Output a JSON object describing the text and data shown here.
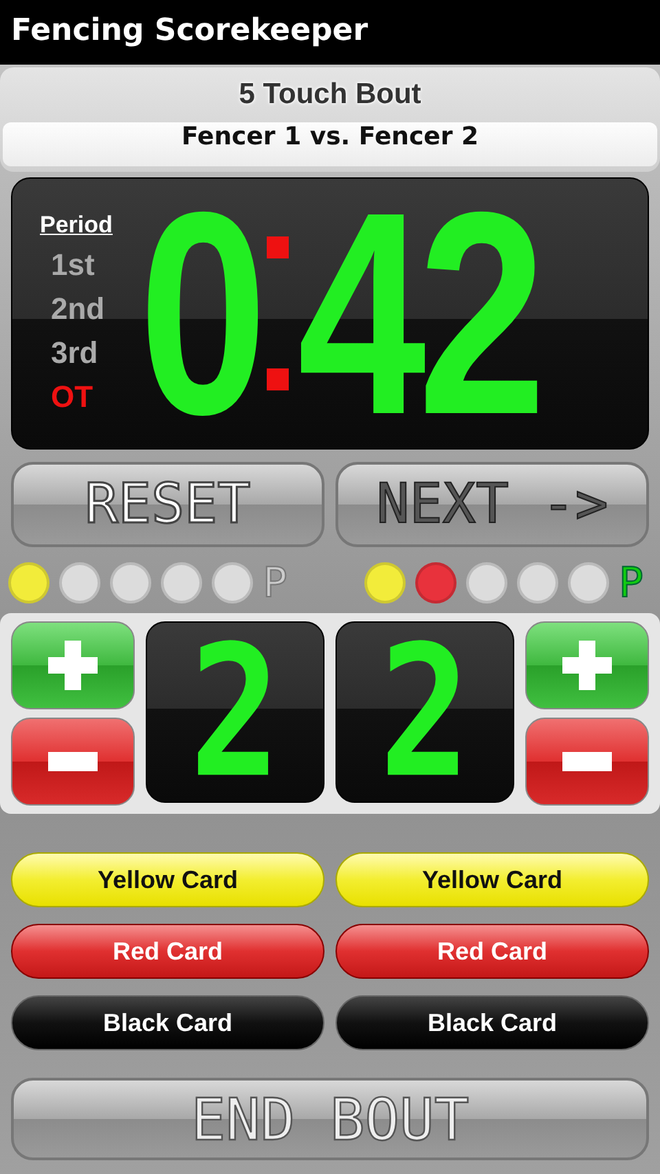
{
  "app_bar": {
    "title": "Fencing Scorekeeper"
  },
  "bout": {
    "name": "5 Touch Bout",
    "matchup": "Fencer 1 vs. Fencer 2"
  },
  "clock": {
    "period_heading": "Period",
    "periods": [
      {
        "label": "1st",
        "selected": false
      },
      {
        "label": "2nd",
        "selected": false
      },
      {
        "label": "3rd",
        "selected": false
      },
      {
        "label": "OT",
        "selected": true
      }
    ],
    "minutes": "0",
    "seconds": "42"
  },
  "clock_buttons": [
    {
      "label": "RESET",
      "kind": "outline"
    },
    {
      "label": "NEXT ->",
      "kind": "plain"
    }
  ],
  "fencers": [
    {
      "lights": [
        {
          "color": "#f2ec3a"
        },
        {
          "color": "#dcdcdc"
        },
        {
          "color": "#dcdcdc"
        },
        {
          "color": "#dcdcdc"
        },
        {
          "color": "#dcdcdc"
        }
      ],
      "priority": {
        "label": "P",
        "on": false
      },
      "score": "2",
      "cards": [
        {
          "kind": "yellow",
          "label": "Yellow Card"
        },
        {
          "kind": "red",
          "label": "Red Card"
        },
        {
          "kind": "black",
          "label": "Black Card"
        }
      ]
    },
    {
      "lights": [
        {
          "color": "#f2ec3a"
        },
        {
          "color": "#e8323c"
        },
        {
          "color": "#dcdcdc"
        },
        {
          "color": "#dcdcdc"
        },
        {
          "color": "#dcdcdc"
        }
      ],
      "priority": {
        "label": "P",
        "on": true
      },
      "score": "2",
      "cards": [
        {
          "kind": "yellow",
          "label": "Yellow Card"
        },
        {
          "kind": "red",
          "label": "Red Card"
        },
        {
          "kind": "black",
          "label": "Black Card"
        }
      ]
    }
  ],
  "end_button": {
    "label": "END BOUT"
  }
}
